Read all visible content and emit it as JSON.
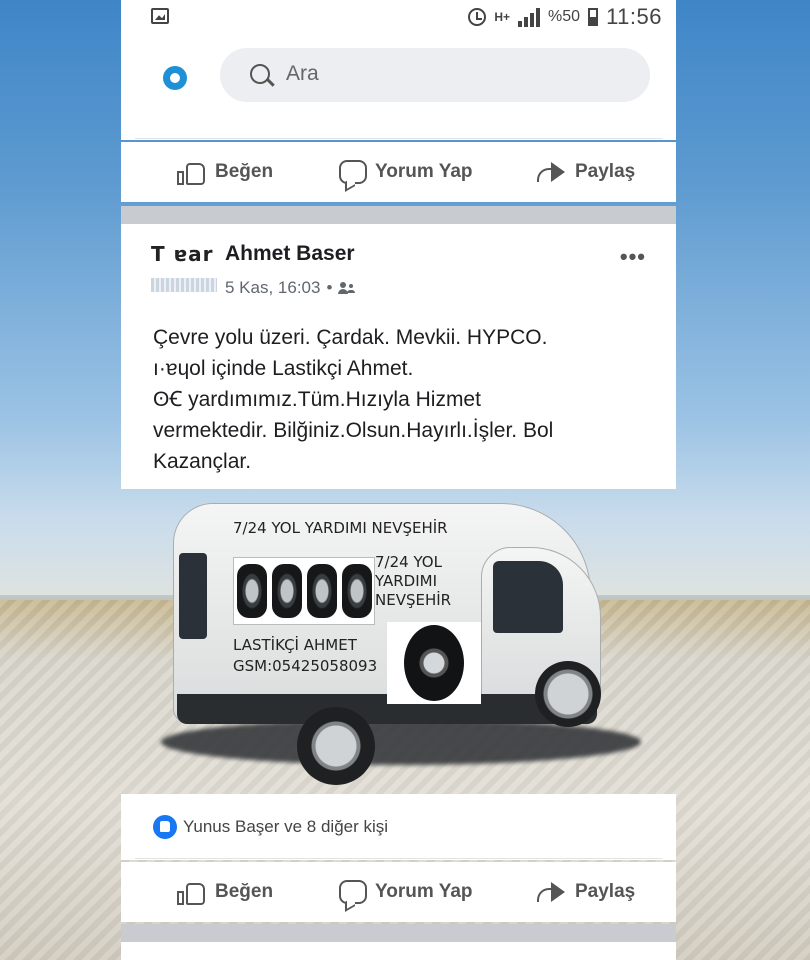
{
  "status_bar": {
    "network": "H+",
    "battery_percent": "%50",
    "time": "11:56"
  },
  "search": {
    "placeholder": "Ara"
  },
  "actions": {
    "like": "Beğen",
    "comment": "Yorum Yap",
    "share": "Paylaş"
  },
  "post": {
    "avatar_text": "T ɐar",
    "author": "Ahmet Baser",
    "timestamp": "5 Kas, 16:03",
    "audience_sep": "•",
    "more": "•••",
    "text_lines": [
      "Çevre yolu üzeri. Çardak. Mevkii. HYPCO.",
      "ı·ɐɥol içinde Lastikçi Ahmet.",
      "ʘꞒ yardımımız.Tüm.Hızıyla Hizmet",
      "vermektedir. Bilğiniz.Olsun.Hayırlı.İşler. Bol",
      "Kazançlar."
    ],
    "image_text": {
      "top": "7/24 YOL YARDIMI NEVŞEHİR",
      "right": [
        "7/24 YOL",
        "YARDIMI",
        "NEVŞEHİR"
      ],
      "name": "LASTİKÇİ AHMET",
      "phone": "GSM:05425058093"
    },
    "reactions": "Yunus Başer ve 8 diğer kişi"
  }
}
